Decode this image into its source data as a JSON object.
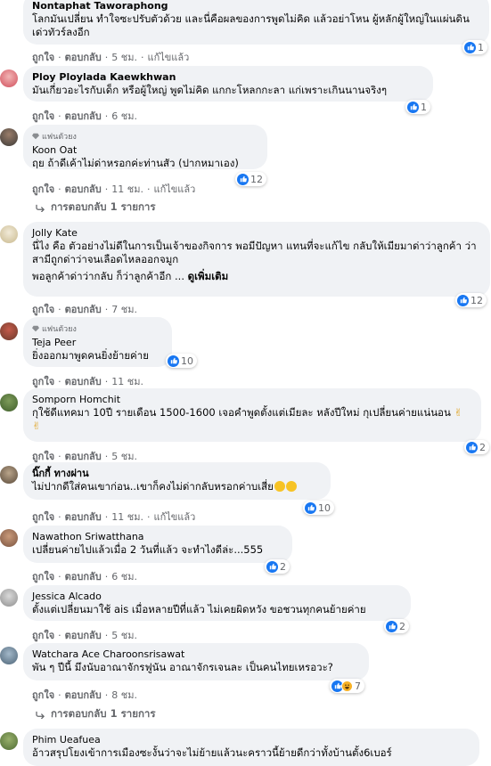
{
  "ui": {
    "like": "ถูกใจ",
    "reply": "ตอบกลับ",
    "edited": "แก้ไขแล้ว",
    "sep": "·",
    "fan_badge": "แฟนตัวยง",
    "see_more": "ดูเพิ่มเติม"
  },
  "colors": {
    "accent": "#1877f2",
    "bubble": "#f0f2f5",
    "meta": "#65676b"
  },
  "comments": [
    {
      "name": "Nontaphat Taworaphong",
      "text": "โลกมันเปลี่ยน ทำใจซะปรับตัวด้วย และนี่คือผลของการพูดไม่คิด แล้วอย่าโหน ผู้หลักผู้ใหญ่ในแผ่นดิน เด่วทัวร์ลงอีก",
      "time": "5 ชม.",
      "edited": true,
      "reactions": "1"
    },
    {
      "name": "Ploy Ploylada Kaewkhwan",
      "text": "มันเกี่ยวอะไรกับเด็ก หรือผู้ใหญ่ พูดไม่คิด แกกะโหลกกะลา แก่เพราะเกินนานจริงๆ",
      "time": "6 ชม.",
      "edited": false,
      "reactions": "1"
    },
    {
      "fan": true,
      "name": "Koon Oat",
      "text": "ฤย ถ้าดีเค้าไม่ด่าหรอกค่ะท่านสัว (ปากหมาเอง)",
      "time": "11 ชม.",
      "edited": true,
      "reactions": "12",
      "replies": "การตอบกลับ 1 รายการ"
    },
    {
      "name": "Jolly Kate",
      "text": "นี่ไง คือ ตัวอย่างไม่ดีในการเป็นเจ้าของกิจการ พอมีปัญหา แทนที่จะแก้ไข กลับให้เมียมาด่าว่าลูกค้า ว่าสามีถูกด่าว่าจนเลือดไหลออกจมูก",
      "text2": "พอลูกค้าด่าว่ากลับ ก็ว่าลูกค้าอีก ...",
      "time": "7 ชม.",
      "edited": false,
      "reactions": "12"
    },
    {
      "fan": true,
      "name": "Teja Peer",
      "text": "ยิ่งออกมาพูดคนยิ่งย้ายค่าย",
      "time": "11 ชม.",
      "edited": false,
      "reactions": "10"
    },
    {
      "name": "Somporn Homchit",
      "text": "กุใช้ดีแทคมา 10ปี รายเดือน 1500-1600 เจอคำพูดตั้งแต่เมียละ หลังปีใหม่ กุเปลี่ยนค่ายแน่นอน",
      "emoji_tail": "✌ ✌",
      "time": "5 ชม.",
      "edited": false,
      "reactions": "2"
    },
    {
      "name": "นิ๊กกี้ ทางผ่าน",
      "text": "ไม่ปากดีใส่คนเขาก่อน..เขาก็คงไม่ด่ากลับหรอกค่าบเสี่ย",
      "time": "11 ชม.",
      "edited": true,
      "reactions": "10"
    },
    {
      "name": "Nawathon Sriwatthana",
      "text": "เปลี่ยนค่ายไปแล้วเมื่อ 2 วันที่แล้ว จะทำไงดีล่ะ...555",
      "time": "6 ชม.",
      "edited": false,
      "reactions": "2"
    },
    {
      "name": "Jessica Alcado",
      "text": "ตั้งแต่เปลี่ยนมาใช้ ais เมื่อหลายปีที่แล้ว ไม่เคยผิดหวัง ขอชวนทุกคนย้ายค่าย",
      "time": "5 ชม.",
      "edited": false,
      "reactions": "2"
    },
    {
      "name": "Watchara Ace Charoonsrisawat",
      "text": "พัน ๆ ปีนี้ มึงนับอาณาจักรฟูนัน อาณาจักรเจนละ เป็นคนไทยเหรอวะ?",
      "time": "8 ชม.",
      "edited": false,
      "reactions": "7",
      "replies": "การตอบกลับ 1 รายการ"
    },
    {
      "name": "Phim Ueafuea",
      "text": "อ้าวสรุปโยงเข้าการเมืองซะงั้นว่าจะไม่ย้ายแล้วนะคราวนี้ย้ายดีกว่าทั้งบ้านตั้ง6เบอร์"
    }
  ]
}
